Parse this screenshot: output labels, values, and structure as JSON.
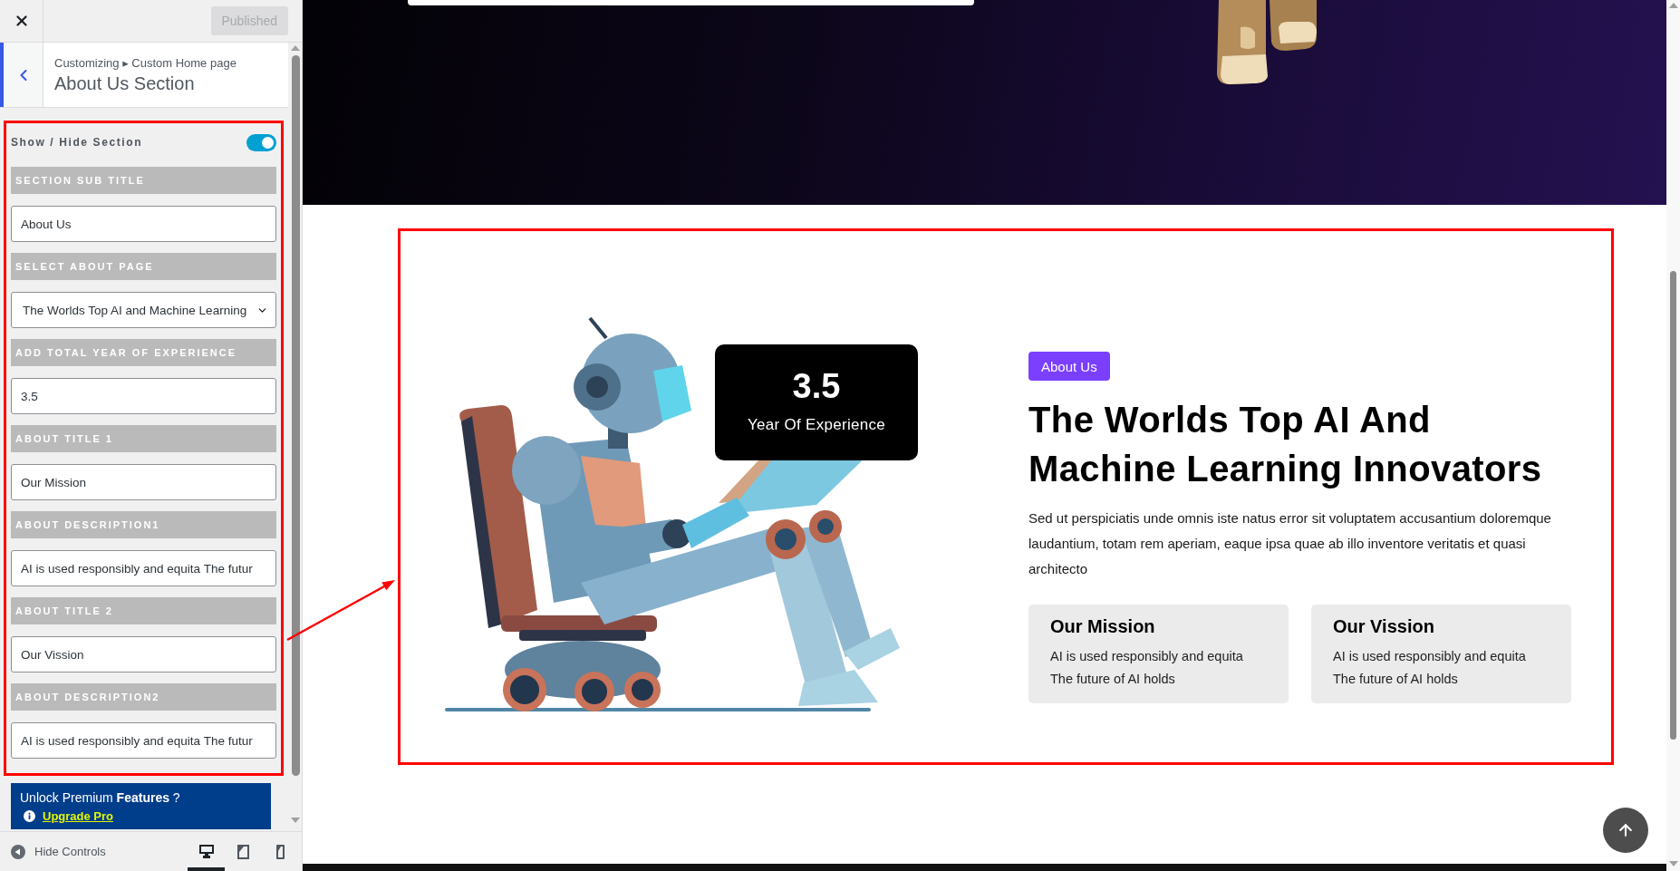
{
  "customizer": {
    "publish_button": {
      "label": "Published",
      "disabled": true
    },
    "breadcrumb": "Customizing ▸ Custom Home page",
    "section_title": "About Us Section",
    "controls": [
      {
        "kind": "toggle",
        "label": "Show / Hide Section",
        "on": true
      },
      {
        "kind": "text",
        "label": "SECTION SUB TITLE",
        "value": "About Us"
      },
      {
        "kind": "select",
        "label": "SELECT ABOUT PAGE",
        "value": "The Worlds Top AI and Machine Learning"
      },
      {
        "kind": "text",
        "label": "ADD TOTAL YEAR OF EXPERIENCE",
        "value": "3.5"
      },
      {
        "kind": "text",
        "label": "ABOUT TITLE 1",
        "value": "Our Mission"
      },
      {
        "kind": "text",
        "label": "ABOUT DESCRIPTION1",
        "value": "AI is used responsibly and equita The futur"
      },
      {
        "kind": "text",
        "label": "ABOUT TITLE 2",
        "value": "Our Vission"
      },
      {
        "kind": "text",
        "label": "ABOUT DESCRIPTION2",
        "value": "AI is used responsibly and equita The futur"
      }
    ],
    "premium": {
      "text": "Unlock Premium **Features** ?",
      "link": "Upgrade Pro"
    },
    "footer": {
      "hide_controls": "Hide Controls",
      "devices": [
        {
          "kind": "desktop",
          "selected": true
        },
        {
          "kind": "tablet",
          "selected": false
        },
        {
          "kind": "mobile",
          "selected": false
        }
      ]
    }
  },
  "preview": {
    "experience": {
      "value": "3.5",
      "label": "Year Of Experience"
    },
    "badge": "About Us",
    "heading": "The Worlds Top AI And Machine Learning Innovators",
    "description": "Sed ut perspiciatis unde omnis iste natus error sit voluptatem accusantium doloremque laudantium, totam rem aperiam, eaque ipsa quae ab illo inventore veritatis et quasi architecto",
    "cards": [
      {
        "title": "Our Mission",
        "text": "AI is used responsibly and equita The future of AI holds"
      },
      {
        "title": "Our Vission",
        "text": "AI is used responsibly and equita The future of AI holds"
      }
    ]
  }
}
